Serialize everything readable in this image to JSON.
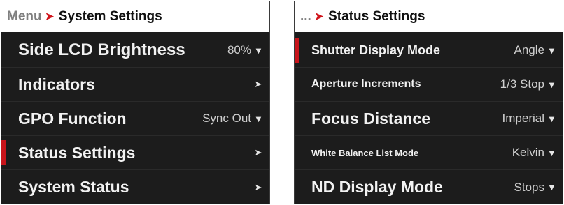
{
  "left_panel": {
    "breadcrumb": {
      "parent": "Menu",
      "separator": "➤",
      "current": "System Settings"
    },
    "items": [
      {
        "label": "Side LCD Brightness",
        "value": "80%",
        "indicator": "▼"
      },
      {
        "label": "Indicators",
        "value": "",
        "indicator": "➤"
      },
      {
        "label": "GPO Function",
        "value": "Sync Out",
        "indicator": "▼"
      },
      {
        "label": "Status Settings",
        "value": "",
        "indicator": "➤"
      },
      {
        "label": "System Status",
        "value": "",
        "indicator": "➤"
      }
    ]
  },
  "right_panel": {
    "breadcrumb": {
      "parent": "...",
      "separator": "➤",
      "current": "Status Settings"
    },
    "items": [
      {
        "label": "Shutter Display Mode",
        "value": "Angle",
        "indicator": "▼"
      },
      {
        "label": "Aperture Increments",
        "value": "1/3 Stop",
        "indicator": "▼"
      },
      {
        "label": "Focus Distance",
        "value": "Imperial",
        "indicator": "▼"
      },
      {
        "label": "White Balance List Mode",
        "value": "Kelvin",
        "indicator": "▼"
      },
      {
        "label": "ND Display Mode",
        "value": "Stops",
        "indicator": "▼"
      }
    ]
  },
  "colors": {
    "accent": "#c8141b",
    "panel_background": "#1c1c1c",
    "header_background": "#ffffff",
    "text": "#f2f2f2",
    "breadcrumb_parent": "#7f7f7f"
  },
  "icons": {
    "submenu": "chevron-right-icon",
    "dropdown": "dropdown-arrow-icon",
    "breadcrumb_separator": "breadcrumb-arrow-icon"
  }
}
